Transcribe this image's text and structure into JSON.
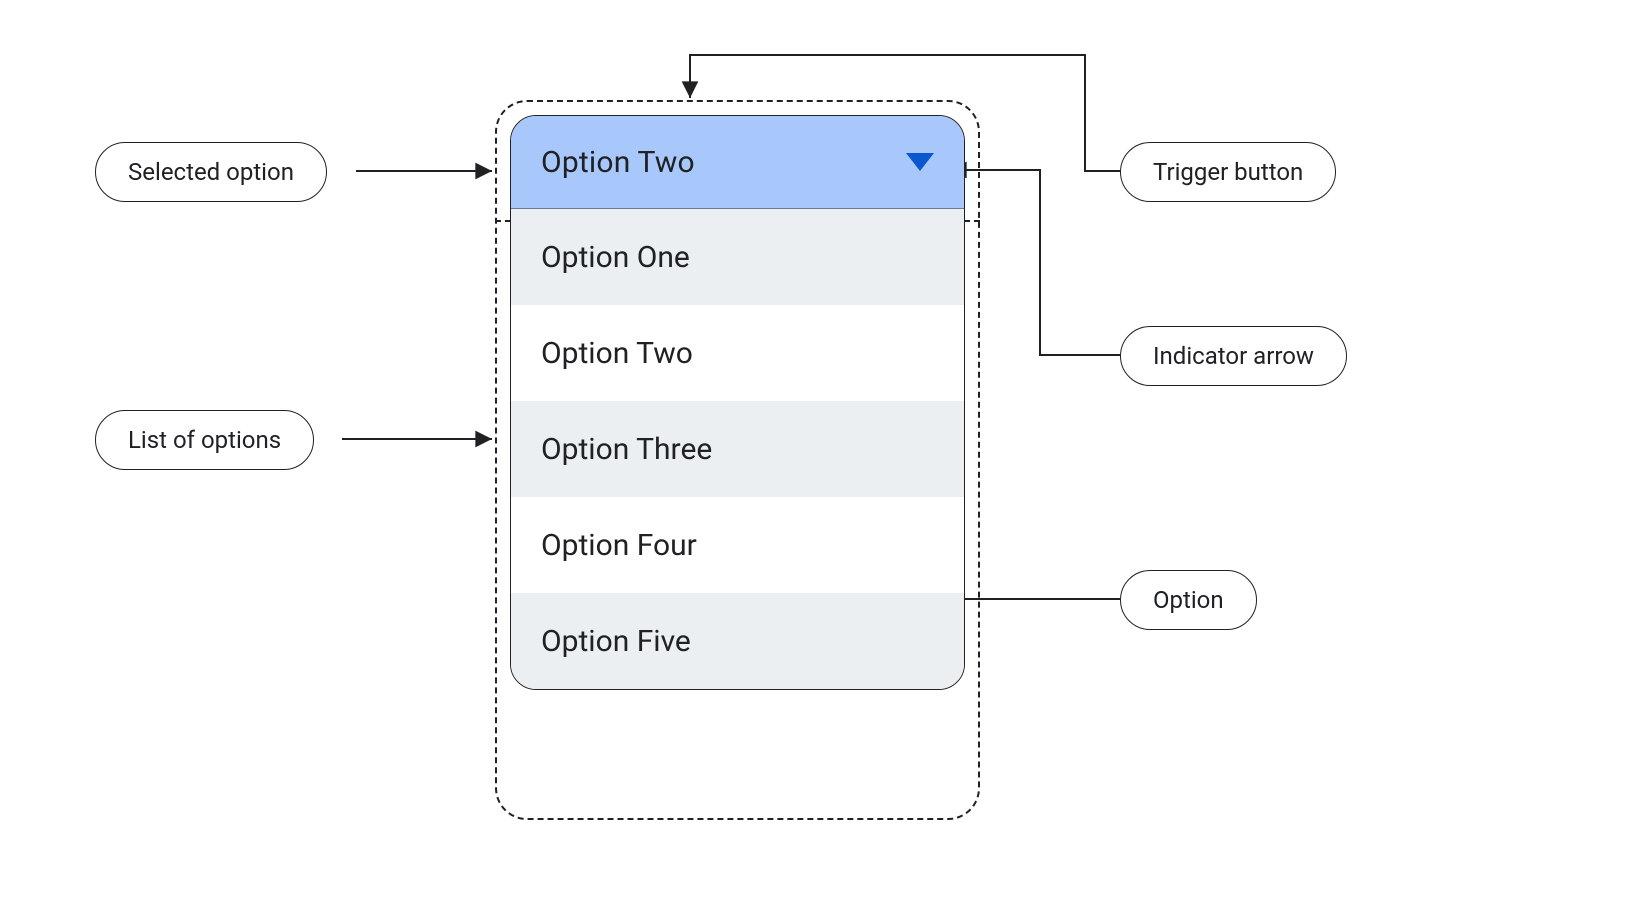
{
  "colors": {
    "trigger_bg": "#a8c7fa",
    "accent": "#0b57d0",
    "alt_row": "#eceff1"
  },
  "dropdown": {
    "selected_label": "Option Two",
    "options": [
      "Option One",
      "Option Two",
      "Option Three",
      "Option  Four",
      "Option Five"
    ]
  },
  "annotations": {
    "selected_option": "Selected option",
    "list_of_options": "List of options",
    "trigger_button": "Trigger button",
    "indicator_arrow": "Indicator arrow",
    "option": "Option"
  }
}
